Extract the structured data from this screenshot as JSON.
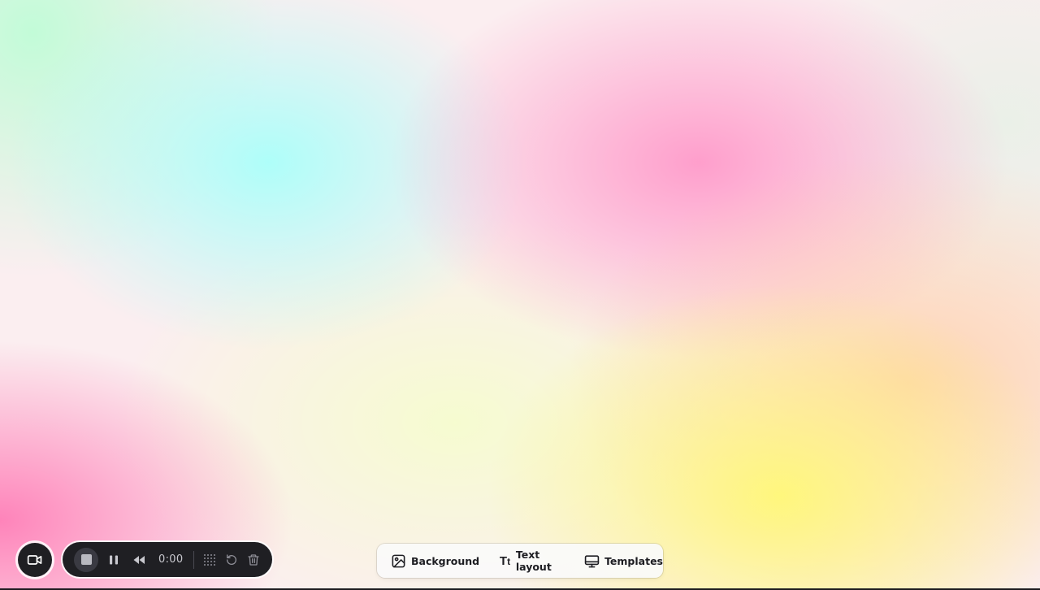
{
  "recorder": {
    "camera_icon": "video-camera-icon",
    "stop_icon": "stop-icon",
    "pause_icon": "pause-icon",
    "rewind_icon": "rewind-icon",
    "time": "0:00",
    "grid_icon": "dot-grid-icon",
    "restart_icon": "restart-icon",
    "trash_icon": "trash-icon"
  },
  "toolbar": {
    "items": [
      {
        "label": "Background",
        "icon": "image-icon"
      },
      {
        "label": "Text layout",
        "icon": "text-size-icon"
      },
      {
        "label": "Templates",
        "icon": "monitor-icon"
      }
    ]
  },
  "colors": {
    "recorder_bg": "#1f1f23",
    "toolbar_bg": "#fafafa"
  }
}
